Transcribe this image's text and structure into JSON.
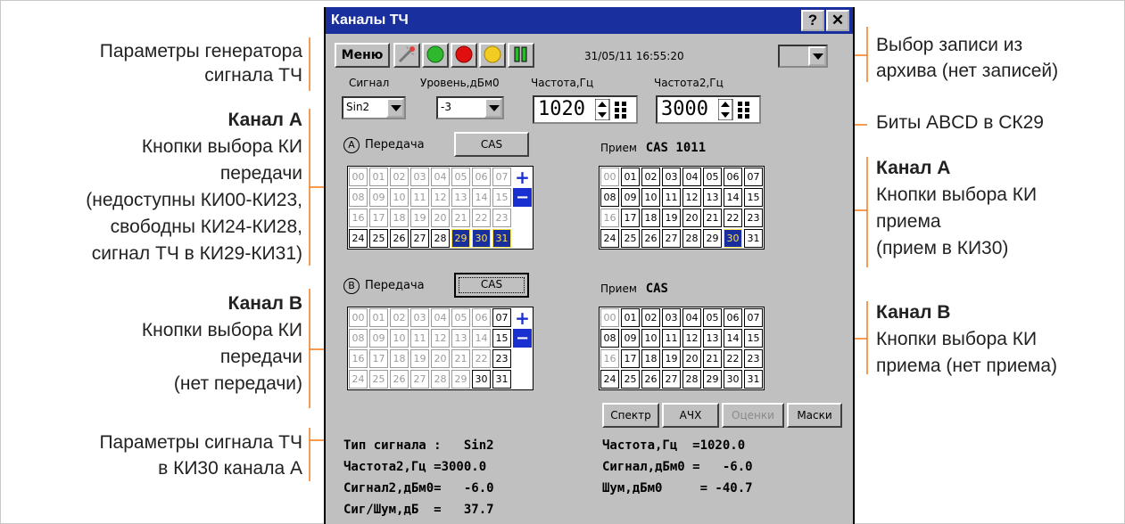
{
  "window": {
    "title": "Каналы ТЧ",
    "help_label": "?",
    "close_label": "✕",
    "menu_label": "Меню",
    "datetime": "31/05/11 16:55:20",
    "archive_value": ""
  },
  "generator": {
    "signal_label": "Сигнал",
    "level_label": "Уровень,дБм0",
    "freq_label": "Частота,Гц",
    "freq2_label": "Частота2,Гц",
    "signal_value": "Sin2",
    "level_value": "-3",
    "freq_value": "1020",
    "freq2_value": "3000"
  },
  "channel_a": {
    "letter": "A",
    "tx_label": "Передача",
    "cas_button": "CAS",
    "rx_label": "Прием",
    "rx_value": "CAS 1011"
  },
  "channel_b": {
    "letter": "B",
    "tx_label": "Передача",
    "cas_button": "CAS",
    "rx_label": "Прием",
    "rx_value": "CAS"
  },
  "grids": {
    "a_tx": {
      "labels": [
        "00",
        "01",
        "02",
        "03",
        "04",
        "05",
        "06",
        "07",
        "08",
        "09",
        "10",
        "11",
        "12",
        "13",
        "14",
        "15",
        "16",
        "17",
        "18",
        "19",
        "20",
        "21",
        "22",
        "23",
        "24",
        "25",
        "26",
        "27",
        "28",
        "29",
        "30",
        "31"
      ],
      "states": [
        "d",
        "d",
        "d",
        "d",
        "d",
        "d",
        "d",
        "d",
        "d",
        "d",
        "d",
        "d",
        "d",
        "d",
        "d",
        "d",
        "d",
        "d",
        "d",
        "d",
        "d",
        "d",
        "d",
        "d",
        "n",
        "n",
        "n",
        "n",
        "n",
        "s",
        "s",
        "s"
      ]
    },
    "a_rx": {
      "labels": [
        "00",
        "01",
        "02",
        "03",
        "04",
        "05",
        "06",
        "07",
        "08",
        "09",
        "10",
        "11",
        "12",
        "13",
        "14",
        "15",
        "16",
        "17",
        "18",
        "19",
        "20",
        "21",
        "22",
        "23",
        "24",
        "25",
        "26",
        "27",
        "28",
        "29",
        "30",
        "31"
      ],
      "states": [
        "d",
        "n",
        "n",
        "n",
        "n",
        "n",
        "n",
        "n",
        "n",
        "n",
        "n",
        "n",
        "n",
        "n",
        "n",
        "n",
        "d",
        "n",
        "n",
        "n",
        "n",
        "n",
        "n",
        "n",
        "n",
        "n",
        "n",
        "n",
        "n",
        "n",
        "s",
        "n"
      ]
    },
    "b_tx": {
      "labels": [
        "00",
        "01",
        "02",
        "03",
        "04",
        "05",
        "06",
        "07",
        "08",
        "09",
        "10",
        "11",
        "12",
        "13",
        "14",
        "15",
        "16",
        "17",
        "18",
        "19",
        "20",
        "21",
        "22",
        "23",
        "24",
        "25",
        "26",
        "27",
        "28",
        "29",
        "30",
        "31"
      ],
      "states": [
        "d",
        "d",
        "d",
        "d",
        "d",
        "d",
        "d",
        "n",
        "d",
        "d",
        "d",
        "d",
        "d",
        "d",
        "d",
        "n",
        "d",
        "d",
        "d",
        "d",
        "d",
        "d",
        "d",
        "n",
        "d",
        "d",
        "d",
        "d",
        "d",
        "d",
        "n",
        "n"
      ]
    },
    "b_rx": {
      "labels": [
        "00",
        "01",
        "02",
        "03",
        "04",
        "05",
        "06",
        "07",
        "08",
        "09",
        "10",
        "11",
        "12",
        "13",
        "14",
        "15",
        "16",
        "17",
        "18",
        "19",
        "20",
        "21",
        "22",
        "23",
        "24",
        "25",
        "26",
        "27",
        "28",
        "29",
        "30",
        "31"
      ],
      "states": [
        "d",
        "n",
        "n",
        "n",
        "n",
        "n",
        "n",
        "n",
        "n",
        "n",
        "n",
        "n",
        "n",
        "n",
        "n",
        "n",
        "d",
        "n",
        "n",
        "n",
        "n",
        "n",
        "n",
        "n",
        "n",
        "n",
        "n",
        "n",
        "n",
        "n",
        "n",
        "n"
      ]
    },
    "plus": "+",
    "minus": "−"
  },
  "buttons": {
    "spectrum": "Спектр",
    "afc": "АЧХ",
    "estimates": "Оценки",
    "masks": "Маски"
  },
  "readout": {
    "row1_left": "Тип сигнала :   Sin2",
    "row1_right": "Частота,Гц  =1020.0",
    "row2_left": "Частота2,Гц =3000.0",
    "row2_right": "Сигнал,дБм0 =   -6.0",
    "row3_left": "Сигнал2,дБм0=   -6.0",
    "row3_right": "Шум,дБм0     = -40.7",
    "row4_left": "Сиг/Шум,дБ  =   37.7"
  },
  "annotations": {
    "gen_line1": "Параметры генератора",
    "gen_line2": "сигнала ТЧ",
    "chA_title": "Канал А",
    "chA_tx_1": "Кнопки выбора КИ",
    "chA_tx_2": "передачи",
    "chA_tx_3": "(недоступны КИ00-КИ23,",
    "chA_tx_4": "свободны КИ24-КИ28,",
    "chA_tx_5": "сигнал ТЧ в КИ29-КИ31)",
    "chB_title": "Канал В",
    "chB_tx_1": "Кнопки выбора КИ",
    "chB_tx_2": "передачи",
    "chB_tx_3": "(нет передачи)",
    "sig_1": "Параметры сигнала ТЧ",
    "sig_2": "в КИ30 канала А",
    "arch_1": "Выбор записи из",
    "arch_2": "архива (нет записей)",
    "abcd": "Биты ABCD в СК29",
    "chA_rx_title": "Канал А",
    "chA_rx_1": "Кнопки выбора КИ",
    "chA_rx_2": "приема",
    "chA_rx_3": "(прием в КИ30)",
    "chB_rx_title": "Канал В",
    "chB_rx_1": "Кнопки выбора КИ",
    "chB_rx_2": "приема (нет приема)"
  },
  "colors": {
    "title_bg": "#1a2f9e",
    "accent_orange": "#f07a1a",
    "selected_text": "#ffe04a"
  }
}
